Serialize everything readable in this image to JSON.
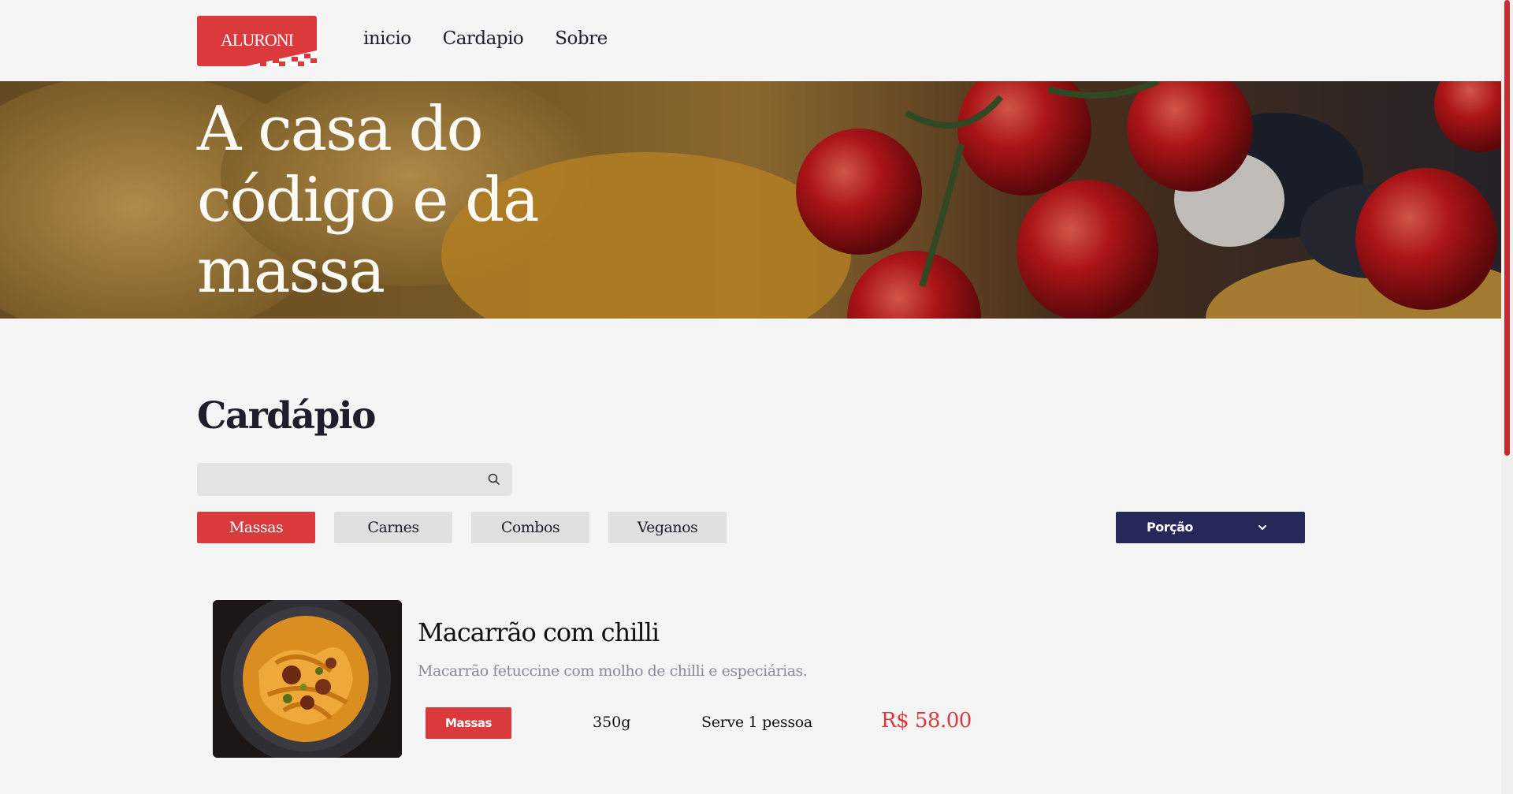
{
  "header": {
    "logo_text": "ALURONI",
    "nav": [
      "inicio",
      "Cardapio",
      "Sobre"
    ]
  },
  "hero": {
    "title": "A casa do código e da massa"
  },
  "menu": {
    "title": "Cardápio",
    "search": {
      "value": "",
      "placeholder": ""
    },
    "tabs": [
      {
        "label": "Massas",
        "active": true
      },
      {
        "label": "Carnes",
        "active": false
      },
      {
        "label": "Combos",
        "active": false
      },
      {
        "label": "Veganos",
        "active": false
      }
    ],
    "sort": {
      "label": "Porção"
    }
  },
  "items": [
    {
      "name": "Macarrão com chilli",
      "description": "Macarrão fetuccine com molho de chilli e especiárias.",
      "category": "Massas",
      "weight": "350g",
      "serves": "Serve 1 pessoa",
      "price": "R$ 58.00"
    }
  ],
  "colors": {
    "brand_red": "#db3a3d",
    "navy": "#27285a",
    "background": "#f5f5f5"
  }
}
